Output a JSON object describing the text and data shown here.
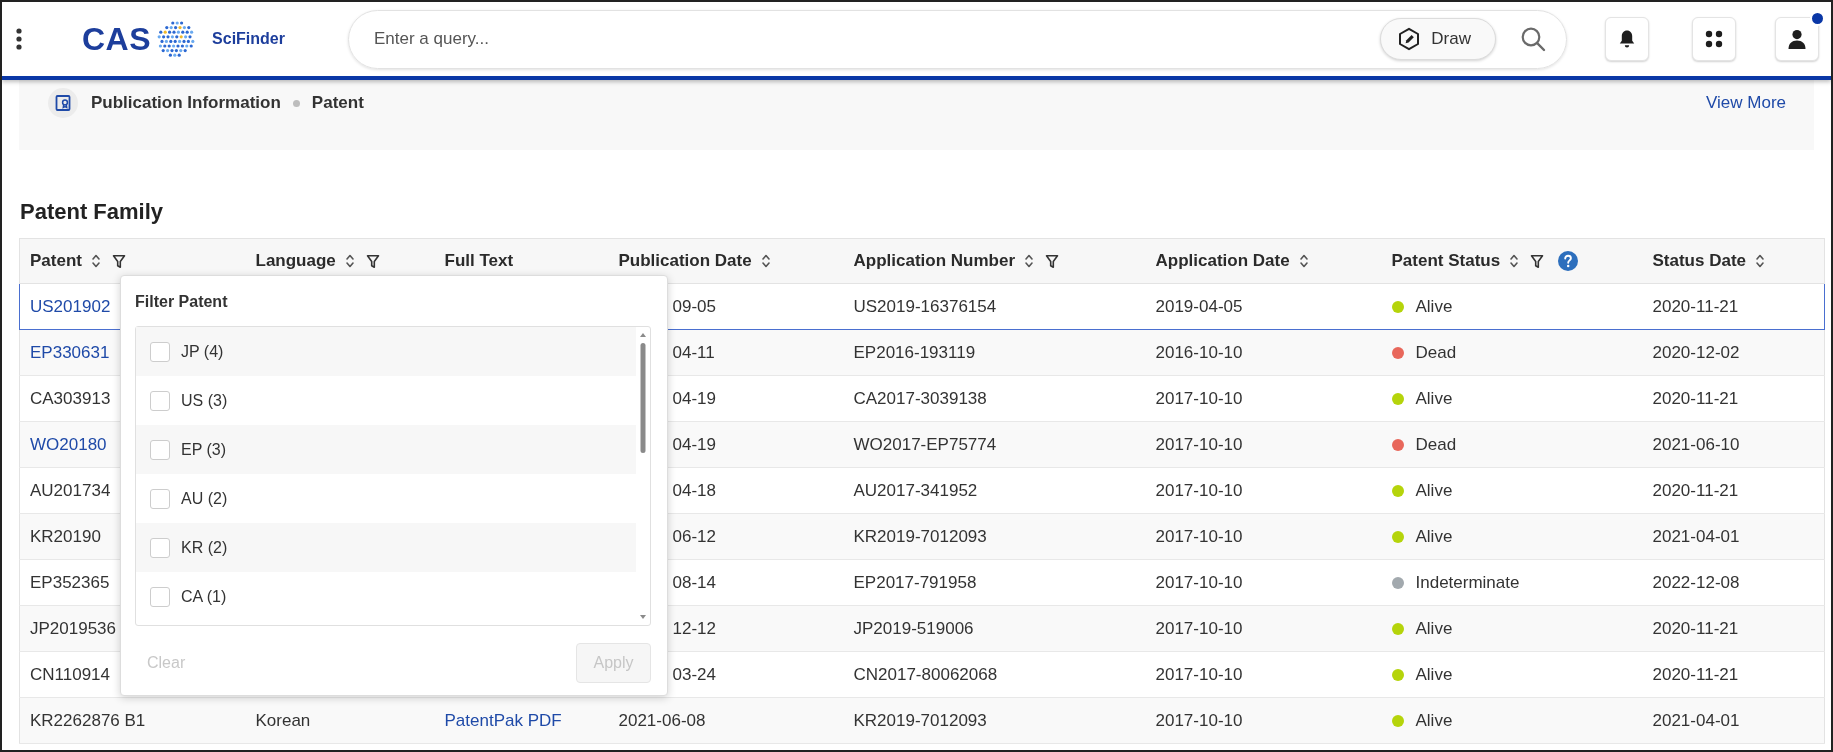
{
  "top_bar": {
    "logo_text": "CAS",
    "product": "SciFinder",
    "search": {
      "placeholder": "Enter a query..."
    },
    "draw_button": "Draw",
    "notification": true
  },
  "breadcrumb": {
    "items": [
      "Publication Information",
      "Patent"
    ],
    "view_more": "View More"
  },
  "section_title": "Patent Family",
  "table": {
    "columns": [
      {
        "label": "Patent",
        "sortable": true,
        "filterable": true,
        "help": false
      },
      {
        "label": "Language",
        "sortable": true,
        "filterable": true,
        "help": false
      },
      {
        "label": "Full Text",
        "sortable": false,
        "filterable": false,
        "help": false
      },
      {
        "label": "Publication Date",
        "sortable": true,
        "filterable": false,
        "help": false
      },
      {
        "label": "Application Number",
        "sortable": true,
        "filterable": true,
        "help": false
      },
      {
        "label": "Application Date",
        "sortable": true,
        "filterable": false,
        "help": false
      },
      {
        "label": "Patent Status",
        "sortable": true,
        "filterable": true,
        "help": true
      },
      {
        "label": "Status Date",
        "sortable": true,
        "filterable": false,
        "help": false
      }
    ],
    "rows": [
      {
        "patent": "US201902",
        "patent_link": true,
        "publication_date": "09-05",
        "application_number": "US2019-16376154",
        "application_date": "2019-04-05",
        "status": {
          "label": "Alive",
          "color": "#b5d40b"
        },
        "status_date": "2020-11-21",
        "selected": true
      },
      {
        "patent": "EP330631",
        "patent_link": true,
        "publication_date": "04-11",
        "application_number": "EP2016-193119",
        "application_date": "2016-10-10",
        "status": {
          "label": "Dead",
          "color": "#e8675b"
        },
        "status_date": "2020-12-02",
        "selected": false
      },
      {
        "patent": "CA303913",
        "patent_link": false,
        "publication_date": "04-19",
        "application_number": "CA2017-3039138",
        "application_date": "2017-10-10",
        "status": {
          "label": "Alive",
          "color": "#b5d40b"
        },
        "status_date": "2020-11-21",
        "selected": false
      },
      {
        "patent": "WO20180",
        "patent_link": true,
        "publication_date": "04-19",
        "application_number": "WO2017-EP75774",
        "application_date": "2017-10-10",
        "status": {
          "label": "Dead",
          "color": "#e8675b"
        },
        "status_date": "2021-06-10",
        "selected": false
      },
      {
        "patent": "AU201734",
        "patent_link": false,
        "publication_date": "04-18",
        "application_number": "AU2017-341952",
        "application_date": "2017-10-10",
        "status": {
          "label": "Alive",
          "color": "#b5d40b"
        },
        "status_date": "2020-11-21",
        "selected": false
      },
      {
        "patent": "KR20190",
        "patent_link": false,
        "publication_date": "06-12",
        "application_number": "KR2019-7012093",
        "application_date": "2017-10-10",
        "status": {
          "label": "Alive",
          "color": "#b5d40b"
        },
        "status_date": "2021-04-01",
        "selected": false
      },
      {
        "patent": "EP352365",
        "patent_link": false,
        "publication_date": "08-14",
        "application_number": "EP2017-791958",
        "application_date": "2017-10-10",
        "status": {
          "label": "Indeterminate",
          "color": "#a2a9ae"
        },
        "status_date": "2022-12-08",
        "selected": false
      },
      {
        "patent": "JP2019536",
        "patent_link": false,
        "publication_date": "12-12",
        "application_number": "JP2019-519006",
        "application_date": "2017-10-10",
        "status": {
          "label": "Alive",
          "color": "#b5d40b"
        },
        "status_date": "2020-11-21",
        "selected": false
      },
      {
        "patent": "CN110914",
        "patent_link": false,
        "publication_date": "03-24",
        "application_number": "CN2017-80062068",
        "application_date": "2017-10-10",
        "status": {
          "label": "Alive",
          "color": "#b5d40b"
        },
        "status_date": "2020-11-21",
        "selected": false
      },
      {
        "patent": "KR2262876 B1",
        "patent_link": false,
        "language": "Korean",
        "full_text": "PatentPak PDF",
        "publication_date": "2021-06-08",
        "application_number": "KR2019-7012093",
        "application_date": "2017-10-10",
        "status": {
          "label": "Alive",
          "color": "#b5d40b"
        },
        "status_date": "2021-04-01",
        "selected": false
      }
    ]
  },
  "filter_popup": {
    "title": "Filter Patent",
    "options": [
      {
        "label": "JP (4)",
        "checked": false
      },
      {
        "label": "US (3)",
        "checked": false
      },
      {
        "label": "EP (3)",
        "checked": false
      },
      {
        "label": "AU (2)",
        "checked": false
      },
      {
        "label": "KR (2)",
        "checked": false
      },
      {
        "label": "CA (1)",
        "checked": false
      }
    ],
    "clear": {
      "label": "Clear",
      "disabled": true
    },
    "apply": {
      "label": "Apply",
      "disabled": true
    }
  }
}
